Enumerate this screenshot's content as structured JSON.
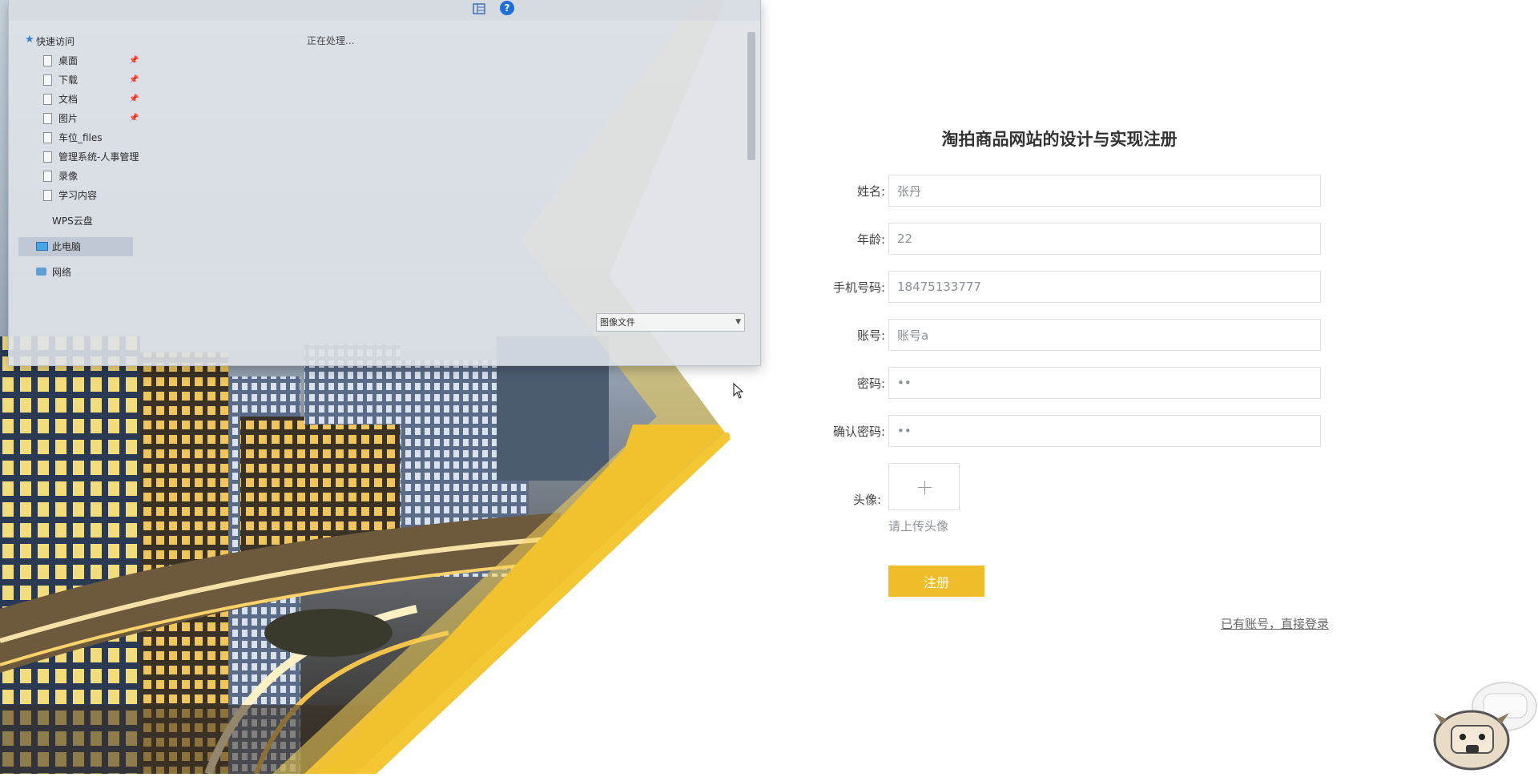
{
  "dialog": {
    "status": "正在处理...",
    "nav_items": [
      {
        "label": "快速访问",
        "icon": "star-icon"
      },
      {
        "label": "桌面",
        "icon": "file-icon",
        "pinned": true
      },
      {
        "label": "下载",
        "icon": "file-icon",
        "pinned": true
      },
      {
        "label": "文档",
        "icon": "file-icon",
        "pinned": true
      },
      {
        "label": "图片",
        "icon": "file-icon",
        "pinned": true
      },
      {
        "label": "车位_files",
        "icon": "file-icon"
      },
      {
        "label": "管理系统-人事管理",
        "icon": "file-icon"
      },
      {
        "label": "录像",
        "icon": "file-icon"
      },
      {
        "label": "学习内容",
        "icon": "file-icon"
      },
      {
        "label": "WPS云盘",
        "icon": "cloud-icon"
      },
      {
        "label": "此电脑",
        "icon": "computer-icon"
      },
      {
        "label": "网络",
        "icon": "network-icon"
      }
    ],
    "file_type": "图像文件"
  },
  "form": {
    "title": "淘拍商品网站的设计与实现注册",
    "fields": [
      {
        "label": "姓名:",
        "value": "张丹"
      },
      {
        "label": "年龄:",
        "value": "22"
      },
      {
        "label": "手机号码:",
        "value": "18475133777"
      },
      {
        "label": "账号:",
        "value": "账号a"
      },
      {
        "label": "密码:",
        "value": "••"
      },
      {
        "label": "确认密码:",
        "value": "••"
      }
    ],
    "avatar_label": "头像:",
    "avatar_hint": "请上传头像",
    "submit_label": "注册",
    "login_link": "已有账号，直接登录"
  },
  "colors": {
    "accent": "#f0bd2a",
    "text": "#333333"
  }
}
